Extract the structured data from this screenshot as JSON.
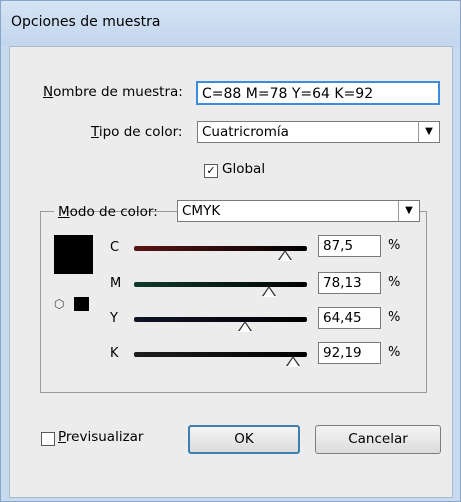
{
  "dialog": {
    "title": "Opciones de muestra",
    "swatch_name_label": "Nombre de muestra:",
    "swatch_name_value": "C=88 M=78 Y=64 K=92",
    "color_type_label": "Tipo de color:",
    "color_type_value": "Cuatricromía",
    "global_label": "Global",
    "global_checked": true,
    "color_mode_label": "Modo de color:",
    "color_mode_value": "CMYK",
    "channels": [
      {
        "letter": "C",
        "value": "87,5",
        "fraction": 0.875,
        "color": "#5a1414"
      },
      {
        "letter": "M",
        "value": "78,13",
        "fraction": 0.7813,
        "color": "#0f3a2c"
      },
      {
        "letter": "Y",
        "value": "64,45",
        "fraction": 0.6445,
        "color": "#111427"
      },
      {
        "letter": "K",
        "value": "92,19",
        "fraction": 0.9219,
        "color": "#1e1e1e"
      }
    ],
    "percent_sign": "%",
    "preview_label": "Previsualizar",
    "preview_checked": false,
    "ok_label": "OK",
    "cancel_label": "Cancelar"
  }
}
